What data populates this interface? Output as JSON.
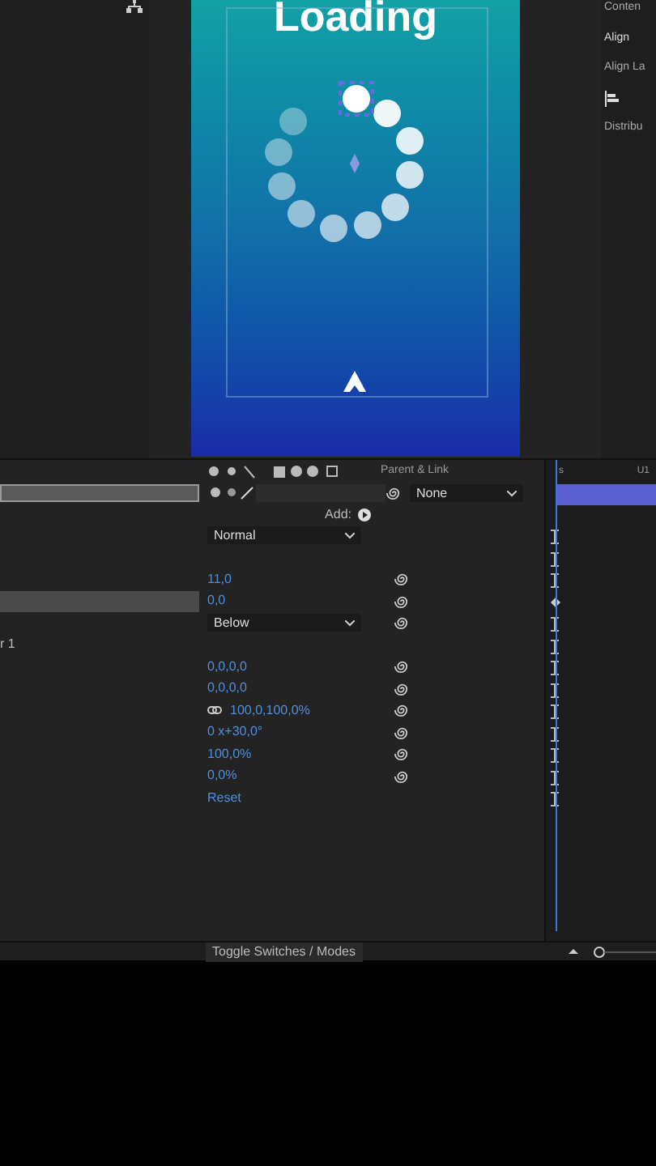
{
  "composition": {
    "title": "Loading"
  },
  "right_panel": {
    "tab": "Conten",
    "section": "Align",
    "align_label": "Align La",
    "distribute_label": "Distribu"
  },
  "ruler": {
    "start": "s",
    "mark": "U1"
  },
  "timeline": {
    "parent_header": "Parent & Link",
    "parent_value": "None",
    "add_label": "Add:",
    "rows": [
      {
        "kind": "dropdown",
        "value": "Normal",
        "stopwatch": false,
        "keyframe": false,
        "highlight": false
      },
      {
        "kind": "empty",
        "stopwatch": false,
        "keyframe": false,
        "highlight": false
      },
      {
        "kind": "value",
        "value": "11,0",
        "stopwatch": true,
        "keyframe": false,
        "highlight": false
      },
      {
        "kind": "value",
        "value": "0,0",
        "stopwatch": true,
        "keyframe": true,
        "highlight": true
      },
      {
        "kind": "dropdown",
        "value": "Below",
        "stopwatch": true,
        "keyframe": false,
        "highlight": false
      },
      {
        "kind": "empty",
        "label": "r 1",
        "stopwatch": false,
        "keyframe": false,
        "highlight": false
      },
      {
        "kind": "value",
        "value": "0,0,0,0",
        "stopwatch": true,
        "keyframe": false,
        "highlight": false
      },
      {
        "kind": "value",
        "value": "0,0,0,0",
        "stopwatch": true,
        "keyframe": false,
        "highlight": false
      },
      {
        "kind": "link",
        "value": "100,0,100,0%",
        "stopwatch": true,
        "keyframe": false,
        "highlight": false
      },
      {
        "kind": "value",
        "value": "0 x+30,0°",
        "stopwatch": true,
        "keyframe": false,
        "highlight": false
      },
      {
        "kind": "value",
        "value": "100,0%",
        "stopwatch": true,
        "keyframe": false,
        "highlight": false
      },
      {
        "kind": "value",
        "value": "0,0%",
        "stopwatch": true,
        "keyframe": false,
        "highlight": false
      },
      {
        "kind": "value",
        "value": "Reset",
        "stopwatch": false,
        "keyframe": false,
        "highlight": false
      }
    ],
    "toggle_button": "Toggle Switches / Modes"
  }
}
